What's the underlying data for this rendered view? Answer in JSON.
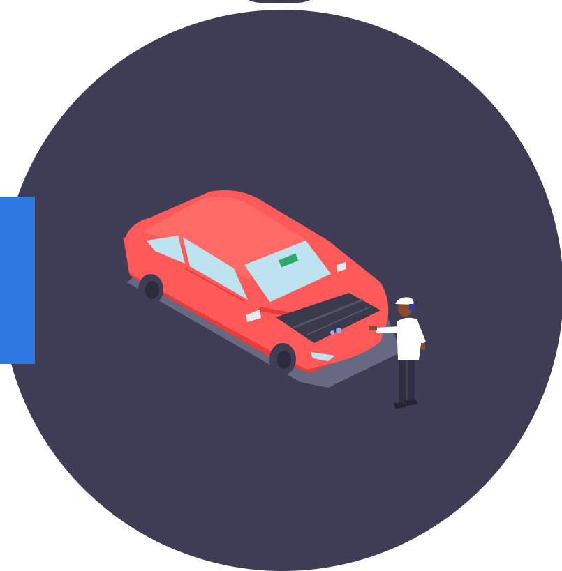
{
  "colors": {
    "background": "#ffffff",
    "circle": "#3f3d56",
    "side_tab": "#2f78e0",
    "car_body": "#ff5a5a",
    "car_shadow_side": "#e83b3b",
    "glass": "#bde3f0",
    "tire": "#3f3d56",
    "ground_shadow": "#6b6d86",
    "engine_bay": "#3a3a4c",
    "worker_shirt": "#ffffff",
    "worker_pants": "#2f2e41",
    "worker_skin": "#8a4b2a",
    "cap": "#ffffff",
    "sticker": "#2ea86b"
  },
  "icons": {
    "car": "car-icon",
    "mechanic": "mechanic-icon"
  }
}
